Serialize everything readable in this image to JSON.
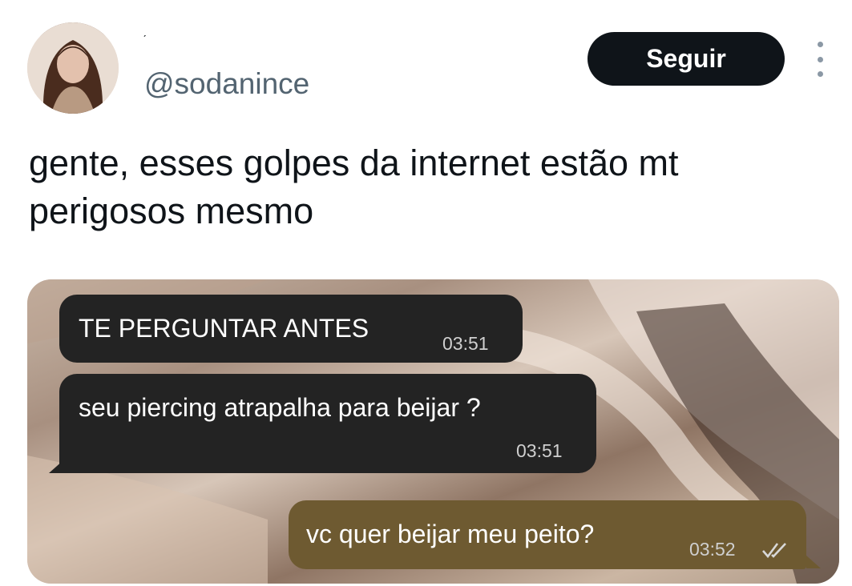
{
  "tweet": {
    "display_name": "ˏ",
    "handle": "@sodanince",
    "follow_label": "Seguir",
    "text": "gente, esses golpes da internet estão mt perigosos mesmo"
  },
  "chat": {
    "messages": [
      {
        "direction": "in",
        "text": "TE PERGUNTAR ANTES",
        "time": "03:51"
      },
      {
        "direction": "in",
        "text": "seu piercing atrapalha para beijar ?",
        "time": "03:51"
      },
      {
        "direction": "out",
        "text": "vc quer beijar meu peito?",
        "time": "03:52",
        "status_icon": "double-check-icon"
      }
    ]
  },
  "colors": {
    "follow_button": "#0f1419",
    "handle_text": "#536471",
    "incoming_bubble": "#232323",
    "outgoing_bubble": "#6e5a31"
  },
  "icons": [
    "avatar-photo",
    "more-options-icon",
    "double-check-icon"
  ]
}
